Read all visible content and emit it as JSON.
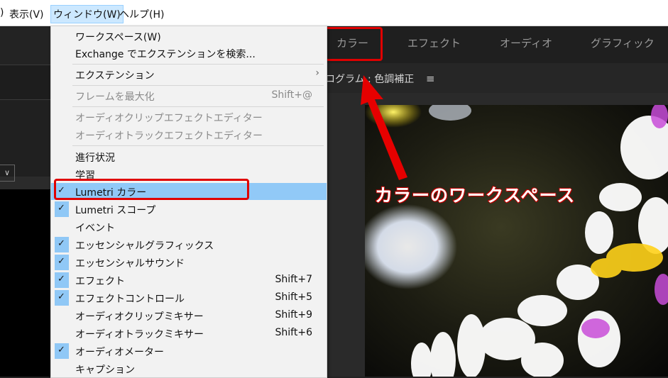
{
  "menubar": {
    "clipped": ")",
    "items": [
      "表示(V)",
      "ウィンドウ(W)",
      "ヘルプ(H)"
    ]
  },
  "workspaces": [
    "カラー",
    "エフェクト",
    "オーディオ",
    "グラフィック"
  ],
  "panel": {
    "title": "ログラム : 色調補正"
  },
  "menu": {
    "items": [
      {
        "label": "ワークスペース(W)",
        "shortcut": "",
        "checked": false,
        "disabled": false
      },
      {
        "label": "Exchange でエクステンションを検索...",
        "shortcut": "",
        "checked": false,
        "disabled": false
      },
      {
        "label": "エクステンション",
        "shortcut": "",
        "checked": false,
        "disabled": false,
        "submenu": true
      },
      {
        "label": "フレームを最大化",
        "shortcut": "Shift+@",
        "checked": false,
        "disabled": true
      },
      {
        "label": "オーディオクリップエフェクトエディター",
        "shortcut": "",
        "checked": false,
        "disabled": true
      },
      {
        "label": "オーディオトラックエフェクトエディター",
        "shortcut": "",
        "checked": false,
        "disabled": true
      },
      {
        "label": "進行状況",
        "shortcut": "",
        "checked": false,
        "disabled": false
      },
      {
        "label": "学習",
        "shortcut": "",
        "checked": false,
        "disabled": false
      },
      {
        "label": "Lumetri カラー",
        "shortcut": "",
        "checked": true,
        "disabled": false,
        "highlighted": true
      },
      {
        "label": "Lumetri スコープ",
        "shortcut": "",
        "checked": true,
        "disabled": false
      },
      {
        "label": "イベント",
        "shortcut": "",
        "checked": false,
        "disabled": false
      },
      {
        "label": "エッセンシャルグラフィックス",
        "shortcut": "",
        "checked": true,
        "disabled": false
      },
      {
        "label": "エッセンシャルサウンド",
        "shortcut": "",
        "checked": true,
        "disabled": false
      },
      {
        "label": "エフェクト",
        "shortcut": "Shift+7",
        "checked": true,
        "disabled": false
      },
      {
        "label": "エフェクトコントロール",
        "shortcut": "Shift+5",
        "checked": true,
        "disabled": false
      },
      {
        "label": "オーディオクリップミキサー",
        "shortcut": "Shift+9",
        "checked": false,
        "disabled": false
      },
      {
        "label": "オーディオトラックミキサー",
        "shortcut": "Shift+6",
        "checked": false,
        "disabled": false
      },
      {
        "label": "オーディオメーター",
        "shortcut": "",
        "checked": true,
        "disabled": false
      },
      {
        "label": "キャプション",
        "shortcut": "",
        "checked": false,
        "disabled": false
      }
    ]
  },
  "annotation": {
    "text": "カラーのワークスペース"
  },
  "icons": {
    "check": "✓",
    "submenu": "›",
    "hamburger": "≡",
    "dropdown": "∨"
  },
  "colors": {
    "highlight": "#91c9f7",
    "annotation_red": "#e00000",
    "panel_bg": "#232323"
  }
}
